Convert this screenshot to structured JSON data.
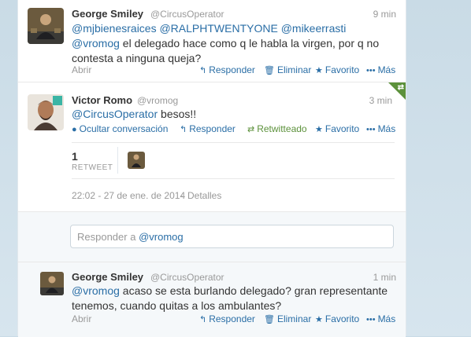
{
  "tweets": [
    {
      "name": "George Smiley",
      "handle": "@CircusOperator",
      "time": "9 min",
      "mentions": "@mjbienesraices @RALPHTWENTYONE @mikeerrasti @vromog",
      "text_after": " el delegado hace como q le habla la virgen, por q no contesta a ninguna queja?",
      "open": "Abrir",
      "actions": {
        "reply": "Responder",
        "delete": "Eliminar",
        "favorite": "Favorito",
        "more": "Más"
      }
    },
    {
      "name": "Victor Romo",
      "handle": "@vromog",
      "time": "3 min",
      "mention": "@CircusOperator",
      "text_after": " besos!!",
      "actions": {
        "hide": "Ocultar conversación",
        "reply": "Responder",
        "retweeted": "Retwitteado",
        "favorite": "Favorito",
        "more": "Más"
      },
      "retweet_count": "1",
      "retweet_label": "RETWEET",
      "timestamp": "22:02 - 27 de ene. de 2014",
      "details": "Detalles"
    },
    {
      "name": "George Smiley",
      "handle": "@CircusOperator",
      "time": "1 min",
      "mention": "@vromog",
      "text_after": " acaso se esta burlando delegado? gran representante tenemos, cuando quitas a los ambulantes?",
      "open": "Abrir",
      "actions": {
        "reply": "Responder",
        "delete": "Eliminar",
        "favorite": "Favorito",
        "more": "Más"
      }
    }
  ],
  "reply_box": {
    "prefix": "Responder a ",
    "target": "@vromog"
  },
  "colors": {
    "link": "#2a6ea6",
    "retweet_green": "#5c913b",
    "muted": "#999999"
  }
}
